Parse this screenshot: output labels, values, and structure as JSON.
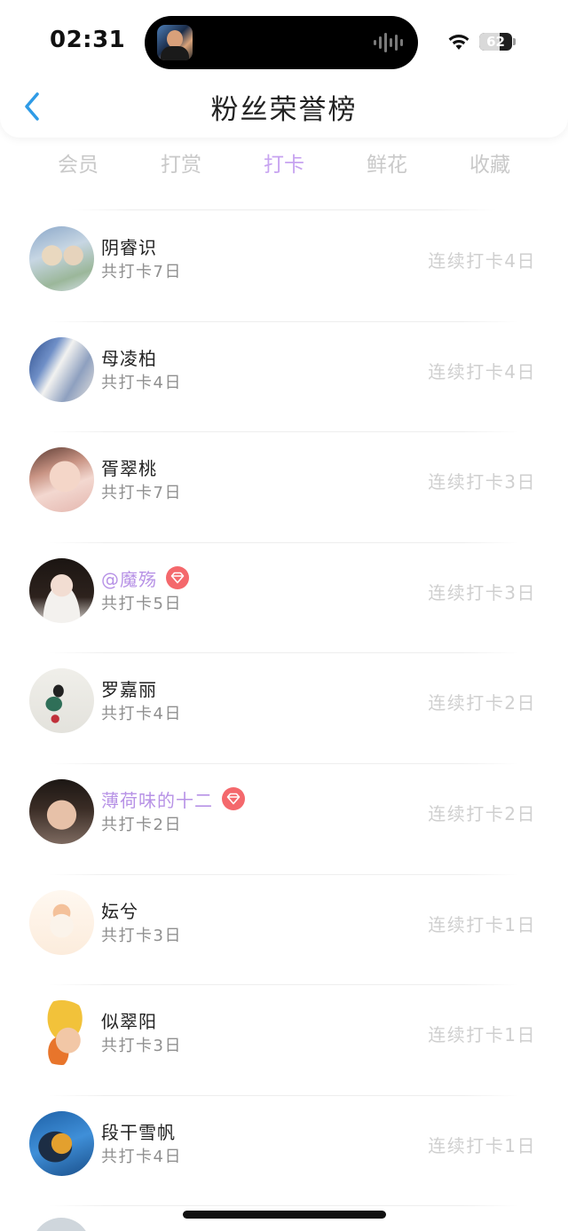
{
  "status_bar": {
    "time": "02:31",
    "battery_level": "62",
    "battery_fraction": 0.62,
    "icons": [
      "now-playing-artwork",
      "audio-waveform-icon",
      "wifi-icon",
      "battery-icon"
    ]
  },
  "nav": {
    "back_icon": "chevron-left-icon",
    "title": "粉丝荣誉榜"
  },
  "tabs": [
    {
      "label": "会员",
      "active": false
    },
    {
      "label": "打赏",
      "active": false
    },
    {
      "label": "打卡",
      "active": true
    },
    {
      "label": "鲜花",
      "active": false
    },
    {
      "label": "收藏",
      "active": false
    }
  ],
  "colors": {
    "accent": "#c7a3f0",
    "vip_name": "#b792e6",
    "badge": "#f4686c",
    "back_arrow": "#2f9be6"
  },
  "fans": [
    {
      "name": "阴睿识",
      "total": "共打卡7日",
      "streak": "连续打卡4日",
      "vip": false
    },
    {
      "name": "母凌柏",
      "total": "共打卡4日",
      "streak": "连续打卡4日",
      "vip": false
    },
    {
      "name": "胥翠桃",
      "total": "共打卡7日",
      "streak": "连续打卡3日",
      "vip": false
    },
    {
      "name": "@魔殇",
      "total": "共打卡5日",
      "streak": "连续打卡3日",
      "vip": true
    },
    {
      "name": "罗嘉丽",
      "total": "共打卡4日",
      "streak": "连续打卡2日",
      "vip": false
    },
    {
      "name": "薄荷味的十二",
      "total": "共打卡2日",
      "streak": "连续打卡2日",
      "vip": true
    },
    {
      "name": "妘兮",
      "total": "共打卡3日",
      "streak": "连续打卡1日",
      "vip": false
    },
    {
      "name": "似翠阳",
      "total": "共打卡3日",
      "streak": "连续打卡1日",
      "vip": false
    },
    {
      "name": "段干雪帆",
      "total": "共打卡4日",
      "streak": "连续打卡1日",
      "vip": false
    }
  ]
}
